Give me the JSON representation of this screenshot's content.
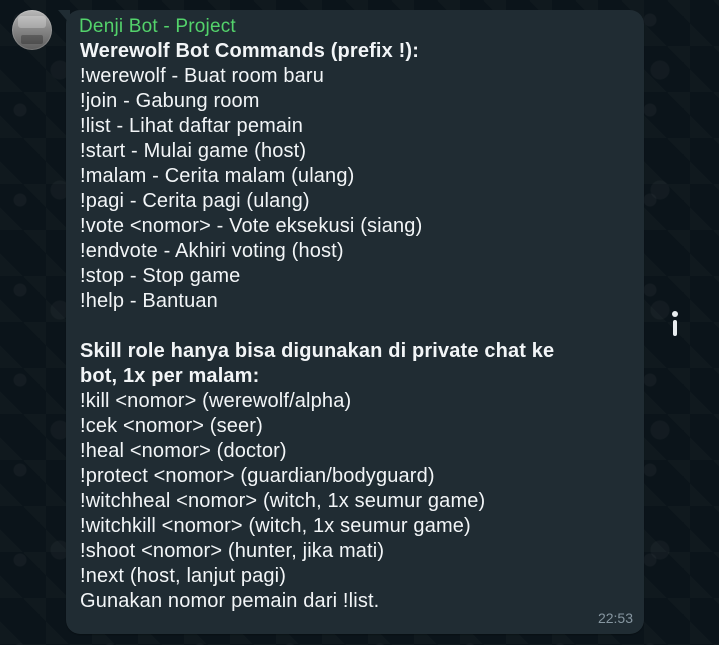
{
  "chat": {
    "sender_name": "Denji Bot - Project",
    "timestamp": "22:53",
    "header_line": "Werewolf Bot Commands (prefix !):",
    "commands": [
      "!werewolf - Buat room baru",
      "!join - Gabung room",
      "!list - Lihat daftar pemain",
      "!start - Mulai game (host)",
      "!malam - Cerita malam (ulang)",
      "!pagi - Cerita pagi (ulang)",
      "!vote <nomor> - Vote eksekusi (siang)",
      "!endvote - Akhiri voting (host)",
      "!stop - Stop game",
      "!help - Bantuan"
    ],
    "skill_header_lines": [
      "Skill role hanya bisa digunakan di private chat ke",
      "bot, 1x per malam:"
    ],
    "skill_commands": [
      "!kill <nomor> (werewolf/alpha)",
      "!cek <nomor> (seer)",
      "!heal <nomor> (doctor)",
      "!protect <nomor> (guardian/bodyguard)",
      "!witchheal <nomor> (witch, 1x seumur game)",
      "!witchkill <nomor> (witch, 1x seumur game)",
      "!shoot <nomor> (hunter, jika mati)",
      "!next (host, lanjut pagi)"
    ],
    "footer_line": "Gunakan nomor pemain dari !list."
  },
  "icons": {
    "avatar": "profile-avatar",
    "info": "info-icon"
  },
  "colors": {
    "background": "#0b141a",
    "bubble": "#202c33",
    "sender": "#53d36b",
    "text": "#f2f5f7",
    "time": "#8696a0"
  }
}
